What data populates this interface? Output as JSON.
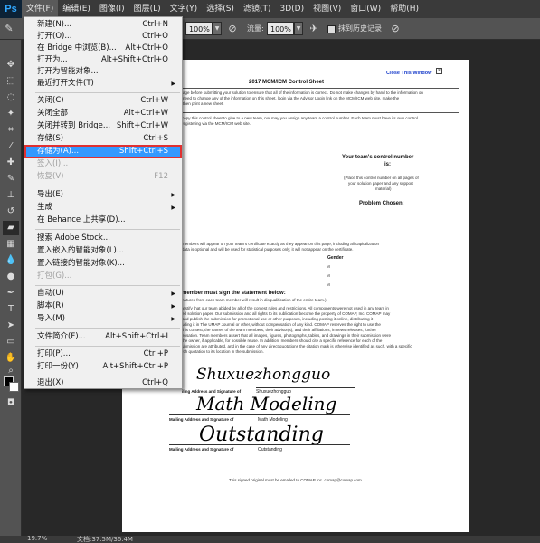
{
  "app": {
    "logo": "Ps"
  },
  "menubar": [
    "文件(F)",
    "编辑(E)",
    "图像(I)",
    "图层(L)",
    "文字(Y)",
    "选择(S)",
    "滤镜(T)",
    "3D(D)",
    "视图(V)",
    "窗口(W)",
    "帮助(H)"
  ],
  "options": {
    "opacity_value": "100%",
    "flow_label": "流量:",
    "flow_value": "100%",
    "history_label": "抹到历史记录"
  },
  "file_menu": {
    "items": [
      {
        "label": "新建(N)...",
        "shortcut": "Ctrl+N"
      },
      {
        "label": "打开(O)...",
        "shortcut": "Ctrl+O"
      },
      {
        "label": "在 Bridge 中浏览(B)...",
        "shortcut": "Alt+Ctrl+O"
      },
      {
        "label": "打开为...",
        "shortcut": "Alt+Shift+Ctrl+O"
      },
      {
        "label": "打开为智能对象...",
        "shortcut": ""
      },
      {
        "label": "最近打开文件(T)",
        "shortcut": "",
        "submenu": "▶"
      },
      {
        "label": "关闭(C)",
        "shortcut": "Ctrl+W"
      },
      {
        "label": "关闭全部",
        "shortcut": "Alt+Ctrl+W"
      },
      {
        "label": "关闭并转到 Bridge...",
        "shortcut": "Shift+Ctrl+W"
      },
      {
        "label": "存储(S)",
        "shortcut": "Ctrl+S"
      },
      {
        "label": "存储为(A)...",
        "shortcut": "Shift+Ctrl+S"
      },
      {
        "label": "签入(I)...",
        "shortcut": ""
      },
      {
        "label": "恢复(V)",
        "shortcut": "F12"
      },
      {
        "label": "导出(E)",
        "shortcut": "",
        "submenu": "▶"
      },
      {
        "label": "生成",
        "shortcut": "",
        "submenu": "▶"
      },
      {
        "label": "在 Behance 上共享(D)...",
        "shortcut": ""
      },
      {
        "label": "搜索 Adobe Stock...",
        "shortcut": ""
      },
      {
        "label": "置入嵌入的智能对象(L)...",
        "shortcut": ""
      },
      {
        "label": "置入链接的智能对象(K)...",
        "shortcut": ""
      },
      {
        "label": "打包(G)...",
        "shortcut": ""
      },
      {
        "label": "自动(U)",
        "shortcut": "",
        "submenu": "▶"
      },
      {
        "label": "脚本(R)",
        "shortcut": "",
        "submenu": "▶"
      },
      {
        "label": "导入(M)",
        "shortcut": "",
        "submenu": "▶"
      },
      {
        "label": "文件简介(F)...",
        "shortcut": "Alt+Shift+Ctrl+I"
      },
      {
        "label": "打印(P)...",
        "shortcut": "Ctrl+P"
      },
      {
        "label": "打印一份(Y)",
        "shortcut": "Alt+Shift+Ctrl+P"
      },
      {
        "label": "退出(X)",
        "shortcut": "Ctrl+Q"
      }
    ]
  },
  "document": {
    "close_link": "Close This Window",
    "title": "2017 MCM/ICM Control Sheet",
    "intro1": "age before submitting your solution to ensure that all of the information is correct. Do not make changes by hand to the information on",
    "intro2": "need to change any of the information on this sheet, login via the Advisor Login link on the MCM/ICM web site, make the",
    "intro3": "then print a new sheet.",
    "intro4": "copy this control sheet to give to a new team, nor may you assign any team a control number. Each team must have its own control",
    "intro5": "registering via the MCM/ICM web site.",
    "control_number_label": "Your team's control number",
    "control_number_sub": "is:",
    "attach_note1": "(Place this control number on all pages of",
    "attach_note2": "your solution paper and any support",
    "attach_note3": "material)",
    "problem_label": "Problem Chosen:",
    "names_note": "members will appear on your team's certificate exactly as they appear on this page, including all capitalization",
    "names_note2": "data is optional and will be used for statistical purposes only, it will not appear on the certificate.",
    "gender_label": "Gender",
    "gender_m1": "M",
    "gender_m2": "M",
    "gender_m3": "M",
    "statement_heading": "member must sign the statement below:",
    "statement_sub": "natures from each team member will result in disqualification of the entire team.)",
    "stmt1": "testify that our team abided by all of the contest rules and restrictions. All components were not used in any team in",
    "stmt2": "ed solution paper. Our submission and all rights to its publication become the property of COMAP, Inc. COMAP may",
    "stmt3": "and publish the submission for promotional use or other purposes, including posting it online, distributing it",
    "stmt4": "uding it in The UMAP Journal or other, without compensation of any kind. COMAP reserves the right to use the",
    "stmt5": "this contest, the names of the team members, their advisor(s), and their affiliations, in news releases, further",
    "stmt6": "ensation. Team members assert that all images, figures, photographs, tables, and drawings in their submission were",
    "stmt7": "the owner, if applicable, for possible reuse. In addition, members should cite a specific reference for each of the",
    "stmt8": "ubmission are attributed, and in the case of any direct quotations the citation mark is otherwise identified as such, with a specific",
    "stmt9": "rch quotation to its location in the submission.",
    "sig1_label": "iling Address and Signature of",
    "sig1_name": "Shuxuezhongguo",
    "sig1_hand": "Shuxuezhongguo",
    "sig2_label": "Mailing Address and Signature of",
    "sig2_name": "Math Modeling",
    "sig2_hand": "Math Modeling",
    "sig3_label": "Mailing Address and Signature of",
    "sig3_name": "Outstanding",
    "sig3_hand": "Outstanding",
    "footer": "This signed original must be emailed to COMAP Inc. comap@comap.com"
  },
  "status": {
    "zoom": "19.7%",
    "doc_info": "文档:37.5M/36.4M"
  }
}
